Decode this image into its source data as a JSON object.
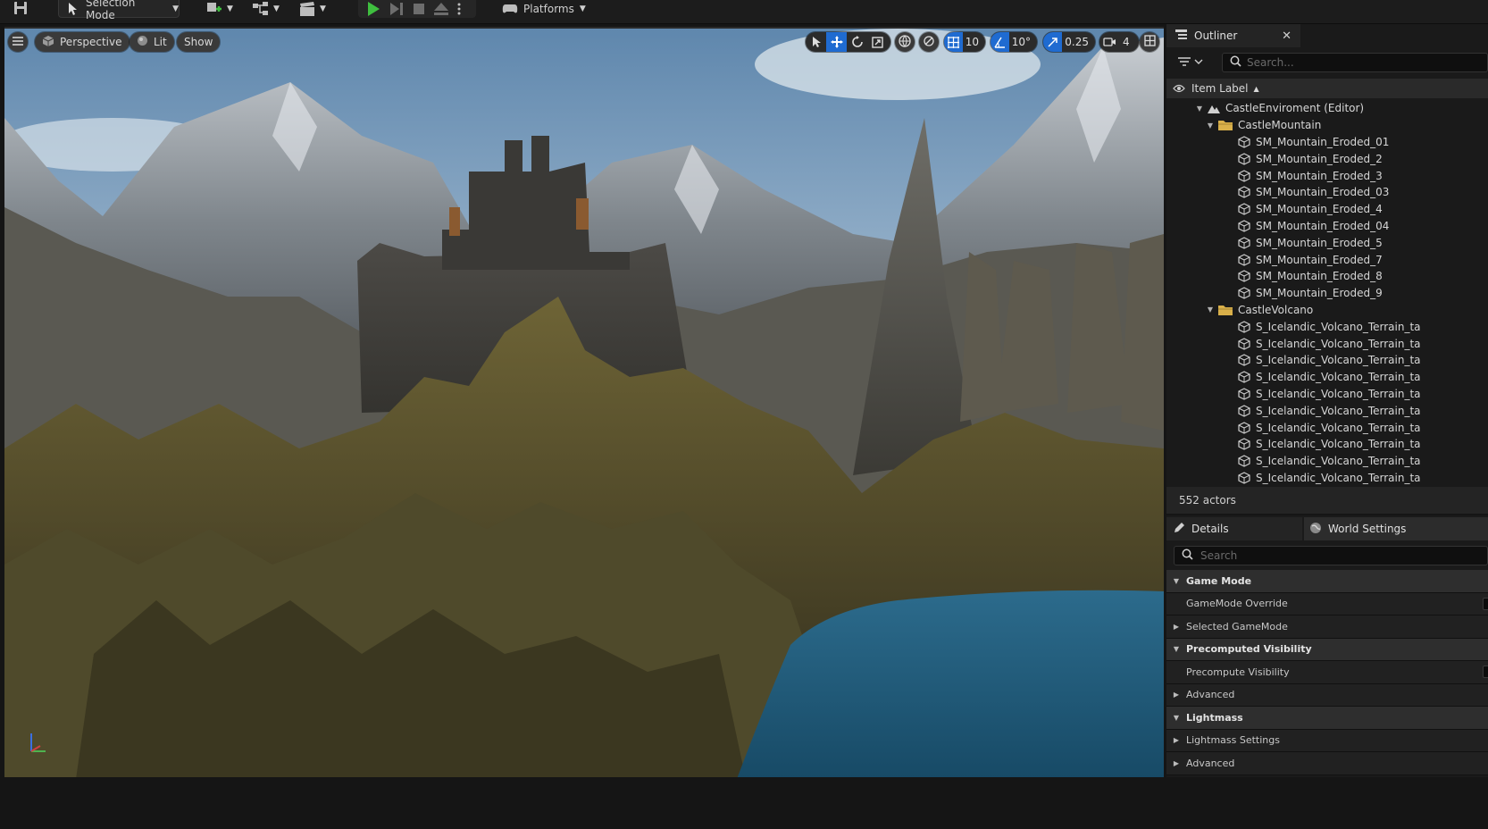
{
  "toolbar": {
    "mode_label": "Selection Mode",
    "platforms_label": "Platforms"
  },
  "viewport": {
    "perspective_label": "Perspective",
    "lit_label": "Lit",
    "show_label": "Show",
    "grid_snap_value": "10",
    "rotation_snap_value": "10°",
    "scale_snap_value": "0.25",
    "camera_speed_value": "4"
  },
  "outliner": {
    "title": "Outliner",
    "search_placeholder": "Search...",
    "column_label": "Item Label",
    "items": [
      {
        "label": "CastleEnviroment (Editor)",
        "depth": 1,
        "kind": "world",
        "expanded": true
      },
      {
        "label": "CastleMountain",
        "depth": 2,
        "kind": "folder",
        "expanded": true
      },
      {
        "label": "SM_Mountain_Eroded_01",
        "depth": 3,
        "kind": "mesh"
      },
      {
        "label": "SM_Mountain_Eroded_2",
        "depth": 3,
        "kind": "mesh"
      },
      {
        "label": "SM_Mountain_Eroded_3",
        "depth": 3,
        "kind": "mesh"
      },
      {
        "label": "SM_Mountain_Eroded_03",
        "depth": 3,
        "kind": "mesh"
      },
      {
        "label": "SM_Mountain_Eroded_4",
        "depth": 3,
        "kind": "mesh"
      },
      {
        "label": "SM_Mountain_Eroded_04",
        "depth": 3,
        "kind": "mesh"
      },
      {
        "label": "SM_Mountain_Eroded_5",
        "depth": 3,
        "kind": "mesh"
      },
      {
        "label": "SM_Mountain_Eroded_7",
        "depth": 3,
        "kind": "mesh"
      },
      {
        "label": "SM_Mountain_Eroded_8",
        "depth": 3,
        "kind": "mesh"
      },
      {
        "label": "SM_Mountain_Eroded_9",
        "depth": 3,
        "kind": "mesh"
      },
      {
        "label": "CastleVolcano",
        "depth": 2,
        "kind": "folder",
        "expanded": true
      },
      {
        "label": "S_Icelandic_Volcano_Terrain_ta",
        "depth": 3,
        "kind": "mesh"
      },
      {
        "label": "S_Icelandic_Volcano_Terrain_ta",
        "depth": 3,
        "kind": "mesh"
      },
      {
        "label": "S_Icelandic_Volcano_Terrain_ta",
        "depth": 3,
        "kind": "mesh"
      },
      {
        "label": "S_Icelandic_Volcano_Terrain_ta",
        "depth": 3,
        "kind": "mesh"
      },
      {
        "label": "S_Icelandic_Volcano_Terrain_ta",
        "depth": 3,
        "kind": "mesh"
      },
      {
        "label": "S_Icelandic_Volcano_Terrain_ta",
        "depth": 3,
        "kind": "mesh"
      },
      {
        "label": "S_Icelandic_Volcano_Terrain_ta",
        "depth": 3,
        "kind": "mesh"
      },
      {
        "label": "S_Icelandic_Volcano_Terrain_ta",
        "depth": 3,
        "kind": "mesh"
      },
      {
        "label": "S_Icelandic_Volcano_Terrain_ta",
        "depth": 3,
        "kind": "mesh"
      },
      {
        "label": "S_Icelandic_Volcano_Terrain_ta",
        "depth": 3,
        "kind": "mesh"
      }
    ],
    "actor_count": "552 actors"
  },
  "details": {
    "tab_details": "Details",
    "tab_world_settings": "World Settings",
    "search_placeholder": "Search",
    "sections": [
      {
        "label": "Game Mode",
        "type": "category",
        "arrow": "down"
      },
      {
        "label": "GameMode Override",
        "type": "property",
        "arrow": "none",
        "checkbox": true
      },
      {
        "label": "Selected GameMode",
        "type": "property",
        "arrow": "right"
      },
      {
        "label": "Precomputed Visibility",
        "type": "category",
        "arrow": "down"
      },
      {
        "label": "Precompute Visibility",
        "type": "property",
        "arrow": "none",
        "checkbox": true
      },
      {
        "label": "Advanced",
        "type": "property",
        "arrow": "right"
      },
      {
        "label": "Lightmass",
        "type": "category",
        "arrow": "down"
      },
      {
        "label": "Lightmass Settings",
        "type": "property",
        "arrow": "right"
      },
      {
        "label": "Advanced",
        "type": "property",
        "arrow": "right"
      }
    ]
  },
  "colors": {
    "accent_blue": "#1f6bd1",
    "play_green": "#3fbf3f",
    "folder_yellow": "#d9b04a"
  }
}
